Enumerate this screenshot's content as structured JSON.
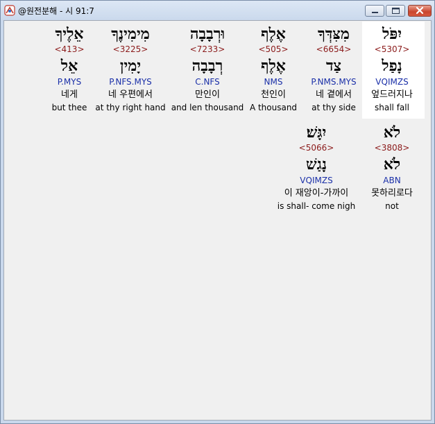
{
  "window": {
    "title": "@원전분해 - 시 91:7"
  },
  "rows": [
    {
      "words": [
        {
          "hebrew": "יִפֹּל",
          "strong": "<5307>",
          "lemma": "נָפַל",
          "morph": "VQIMZS",
          "korean": "엎드러지나",
          "english": "shall fall",
          "highlighted": true
        },
        {
          "hebrew": "מִצִּדְּךָ",
          "strong": "<6654>",
          "lemma": "צַד",
          "morph": "P.NMS.MYS",
          "korean": "네 곁에서",
          "english": "at thy side",
          "highlighted": false
        },
        {
          "hebrew": "אֶלֶף",
          "strong": "<505>",
          "lemma": "אֶלֶף",
          "morph": "NMS",
          "korean": "천인이",
          "english": "A thousand",
          "highlighted": false
        },
        {
          "hebrew": "וּרְבָבָה",
          "strong": "<7233>",
          "lemma": "רְבָבָה",
          "morph": "C.NFS",
          "korean": "만인이",
          "english": "and len thousand",
          "highlighted": false
        },
        {
          "hebrew": "מִימִינֶךָ",
          "strong": "<3225>",
          "lemma": "יָמִין",
          "morph": "P.NFS.MYS",
          "korean": "네 우편에서",
          "english": "at thy right hand",
          "highlighted": false
        },
        {
          "hebrew": "אֵלֶיךָ",
          "strong": "<413>",
          "lemma": "אֵל",
          "morph": "P.MYS",
          "korean": "네게",
          "english": "but thee",
          "highlighted": false
        }
      ]
    },
    {
      "words": [
        {
          "hebrew": "לֹא",
          "strong": "<3808>",
          "lemma": "לֹא",
          "morph": "ABN",
          "korean": "못하리로다",
          "english": "not",
          "highlighted": false
        },
        {
          "hebrew": "יִגָּשׁ׃",
          "strong": "<5066>",
          "lemma": "נָגַשׁ",
          "morph": "VQIMZS",
          "korean": "이 재앙이-가까이",
          "english": "is shall- come nigh",
          "highlighted": false
        }
      ]
    }
  ]
}
